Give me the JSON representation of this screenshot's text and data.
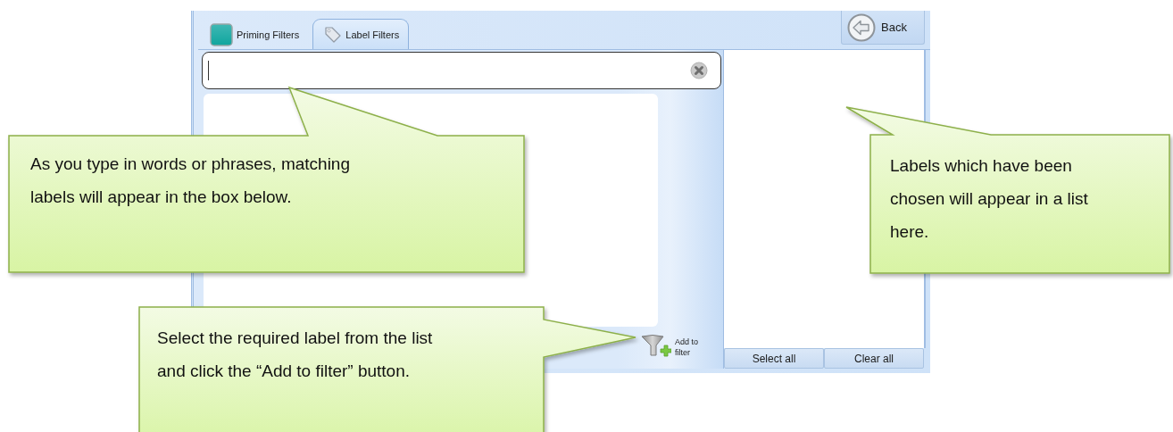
{
  "tabs": [
    {
      "label": "Priming Filters",
      "selected": false
    },
    {
      "label": "Label Filters",
      "selected": true
    }
  ],
  "back_button": {
    "label": "Back"
  },
  "add_button": {
    "label": "Add to filter"
  },
  "buttons": [
    "Select all",
    "Clear all"
  ],
  "callouts": [
    {
      "text": "As you type in words or phrases, matching labels will appear in the box below."
    },
    {
      "text": "Labels which have been chosen will appear in a list here."
    },
    {
      "text": "Select the required label from the list and click the “Add to filter” button."
    }
  ]
}
